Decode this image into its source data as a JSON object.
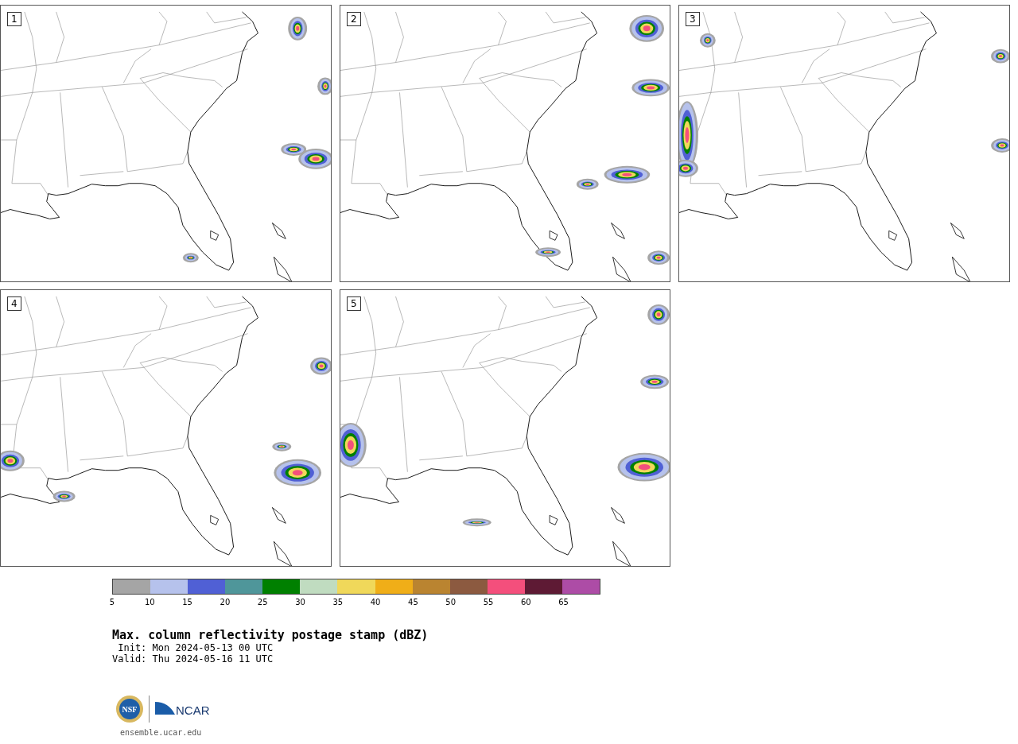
{
  "panels": [
    {
      "label": "1"
    },
    {
      "label": "2"
    },
    {
      "label": "3"
    },
    {
      "label": "4"
    },
    {
      "label": "5"
    }
  ],
  "colorbar": {
    "bins": [
      {
        "color": "#a5a5a5"
      },
      {
        "color": "#b6c2ec"
      },
      {
        "color": "#5060d5"
      },
      {
        "color": "#4f969a"
      },
      {
        "color": "#008000"
      },
      {
        "color": "#c0dcc0"
      },
      {
        "color": "#f0d85a"
      },
      {
        "color": "#f0ae18"
      },
      {
        "color": "#ba8430"
      },
      {
        "color": "#8c5a40"
      },
      {
        "color": "#f44f7c"
      },
      {
        "color": "#5e1a34"
      },
      {
        "color": "#ad4ca6"
      }
    ],
    "ticks": [
      "5",
      "10",
      "15",
      "20",
      "25",
      "30",
      "35",
      "40",
      "45",
      "50",
      "55",
      "60",
      "65"
    ]
  },
  "title": "Max. column reflectivity postage stamp (dBZ)",
  "init": " Init: Mon 2024-05-13 00 UTC",
  "valid": "Valid: Thu 2024-05-16 11 UTC",
  "logo": {
    "nsf": "NSF",
    "ncar": "NCAR"
  },
  "site": "ensemble.ucar.edu"
}
